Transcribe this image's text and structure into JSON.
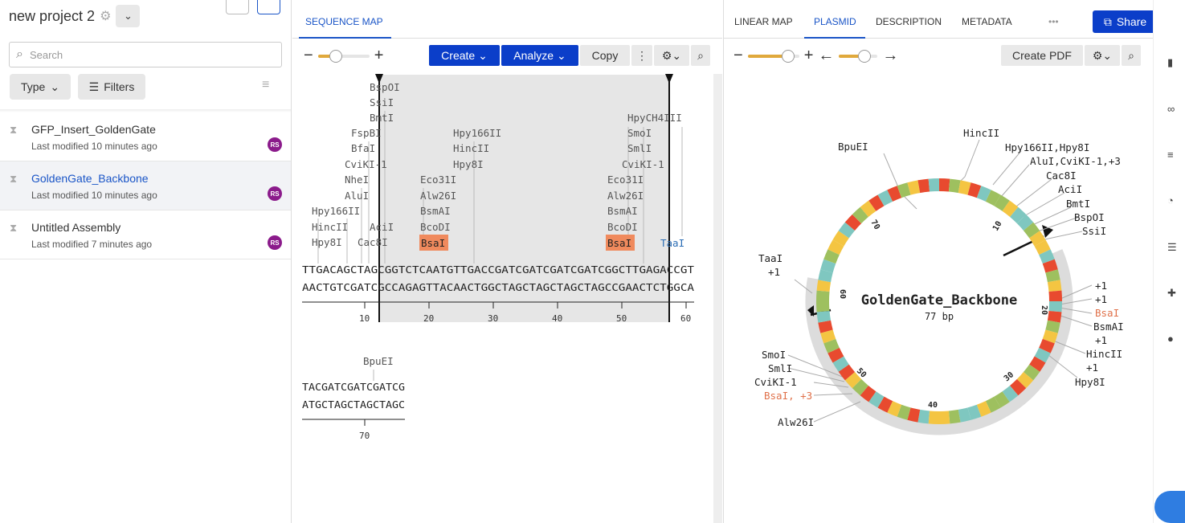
{
  "sidebar": {
    "project_title": "new project 2",
    "search_placeholder": "Search",
    "type_label": "Type",
    "filters_label": "Filters",
    "files": [
      {
        "name": "GFP_Insert_GoldenGate",
        "modified": "Last modified 10 minutes ago",
        "avatar": "RS"
      },
      {
        "name": "GoldenGate_Backbone",
        "modified": "Last modified 10 minutes ago",
        "avatar": "RS"
      },
      {
        "name": "Untitled Assembly",
        "modified": "Last modified 7 minutes ago",
        "avatar": "RS"
      }
    ]
  },
  "sequence_pane": {
    "tab": "SEQUENCE MAP",
    "buttons": {
      "create": "Create",
      "analyze": "Analyze",
      "copy": "Copy"
    },
    "row1": {
      "top_strand": "TTGACAGCTAGCGGTCTCAATGTTGACCGATCGATCGATCGATCGGCTTGAGACCGT",
      "bottom_strand": "AACTGTCGATCGCCAGAGTTACAACTGGCTAGCTAGCTAGCTAGCCGAACTCTGGCA",
      "ticks": [
        "10",
        "20",
        "30",
        "40",
        "50",
        "60"
      ]
    },
    "row2": {
      "top_strand": "TACGATCGATCGATCG",
      "bottom_strand": "ATGCTAGCTAGCTAGC",
      "tick": "70",
      "enzyme": "BpuEI"
    },
    "enzymes_row1": [
      {
        "label": "BspOI"
      },
      {
        "label": "SsiI"
      },
      {
        "label": "BmtI"
      },
      {
        "label": "FspBI"
      },
      {
        "label": "BfaI"
      },
      {
        "label": "CviKI-1"
      },
      {
        "label": "NheI"
      },
      {
        "label": "AluI"
      },
      {
        "label": "Hpy166II"
      },
      {
        "label": "HincII"
      },
      {
        "label": "Hpy8I"
      },
      {
        "label": "AciI"
      },
      {
        "label": "Cac8I"
      },
      {
        "label": "Hpy166II"
      },
      {
        "label": "HincII"
      },
      {
        "label": "Hpy8I"
      },
      {
        "label": "Eco31I"
      },
      {
        "label": "Alw26I"
      },
      {
        "label": "BsmAI"
      },
      {
        "label": "BcoDI"
      },
      {
        "label": "BsaI"
      },
      {
        "label": "HpyCH4III"
      },
      {
        "label": "SmoI"
      },
      {
        "label": "SmlI"
      },
      {
        "label": "CviKI-1"
      },
      {
        "label": "Eco31I"
      },
      {
        "label": "Alw26I"
      },
      {
        "label": "BsmAI"
      },
      {
        "label": "BcoDI"
      },
      {
        "label": "BsaI"
      },
      {
        "label": "TaaI"
      }
    ]
  },
  "map_pane": {
    "tabs": [
      "LINEAR MAP",
      "PLASMID",
      "DESCRIPTION",
      "METADATA",
      "•••"
    ],
    "active_tab": "PLASMID",
    "share_label": "Share",
    "create_pdf_label": "Create PDF",
    "plasmid_name": "GoldenGate_Backbone",
    "plasmid_length": "77 bp",
    "ring_ticks": [
      "10",
      "20",
      "30",
      "40",
      "50",
      "60",
      "70"
    ],
    "labels_right": [
      "HincII",
      "Hpy166II,Hpy8I",
      "AluI,CviKI-1,+3",
      "Cac8I",
      "AciI",
      "BmtI",
      "BspOI",
      "SsiI"
    ],
    "labels_right_low": [
      "+1",
      "+1",
      "BsaI",
      "BsmAI",
      "+1",
      "HincII",
      "+1",
      "Hpy8I"
    ],
    "labels_left_top": [
      "BpuEI"
    ],
    "labels_left_mid": [
      "TaaI",
      "+1"
    ],
    "labels_left_low": [
      "SmoI",
      "SmlI",
      "CviKI-1",
      "BsaI, +3",
      "Alw26I"
    ]
  },
  "colors": {
    "brand_blue": "#0b3ec9",
    "bsai_highlight": "#f08a5d",
    "avatar": "#8b1b8b"
  }
}
